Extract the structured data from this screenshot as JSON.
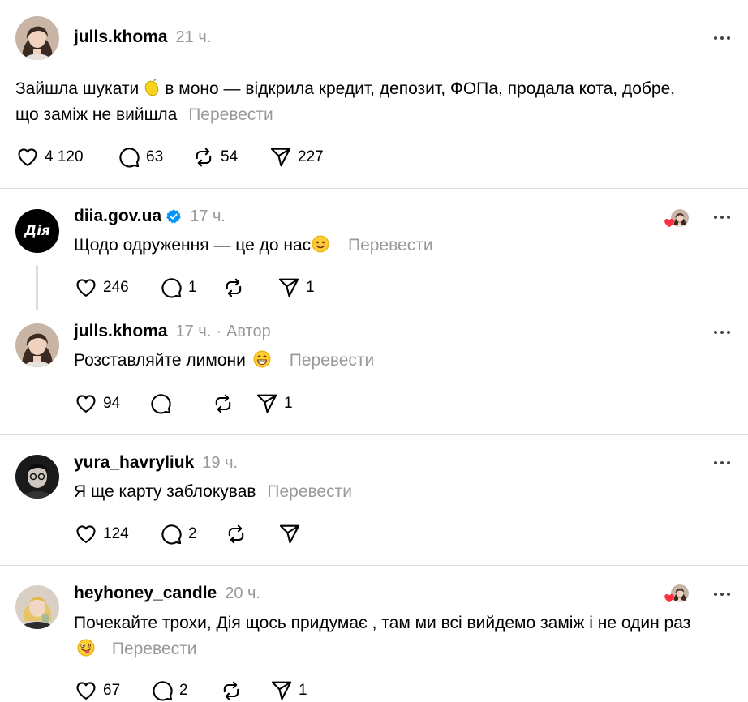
{
  "post": {
    "username": "julls.khoma",
    "time": "21 ч.",
    "text_before": "Зайшла шукати",
    "text_after": "в моно — відкрила кредит, депозит, ФОПа, продала кота, добре,",
    "text_line2": "що заміж не вийшла",
    "translate": "Перевести",
    "likes": "4 120",
    "comments": "63",
    "reposts": "54",
    "shares": "227"
  },
  "replies": [
    {
      "username": "diia.gov.ua",
      "verified": true,
      "time": "17 ч.",
      "text": "Щодо одруження — це до нас",
      "translate": "Перевести",
      "likes": "246",
      "comments": "1",
      "reposts": "",
      "shares": "1",
      "avatar_text": "Дія"
    },
    {
      "username": "julls.khoma",
      "time": "17 ч.",
      "author_sep": "·",
      "author_label": "Автор",
      "text": "Розставляйте лимони",
      "translate": "Перевести",
      "likes": "94",
      "comments": "",
      "reposts": "",
      "shares": "1"
    },
    {
      "username": "yura_havryliuk",
      "time": "19 ч.",
      "text": "Я ще карту заблокував",
      "translate": "Перевести",
      "likes": "124",
      "comments": "2",
      "reposts": "",
      "shares": ""
    },
    {
      "username": "heyhoney_candle",
      "time": "20 ч.",
      "text": "Почекайте трохи, Дія щось придумає , там ми всі вийдемо заміж і не один раз",
      "translate": "Перевести",
      "likes": "67",
      "comments": "2",
      "reposts": "",
      "shares": "1"
    }
  ],
  "icons": {
    "like": "heart-icon",
    "comment": "comment-icon",
    "repost": "repost-icon",
    "share": "send-icon",
    "more": "more-icon",
    "verified": "verified-badge-icon"
  },
  "colors": {
    "muted": "#999999",
    "verified": "#0095f6",
    "heart": "#ff3040",
    "divider": "#dddddd"
  }
}
